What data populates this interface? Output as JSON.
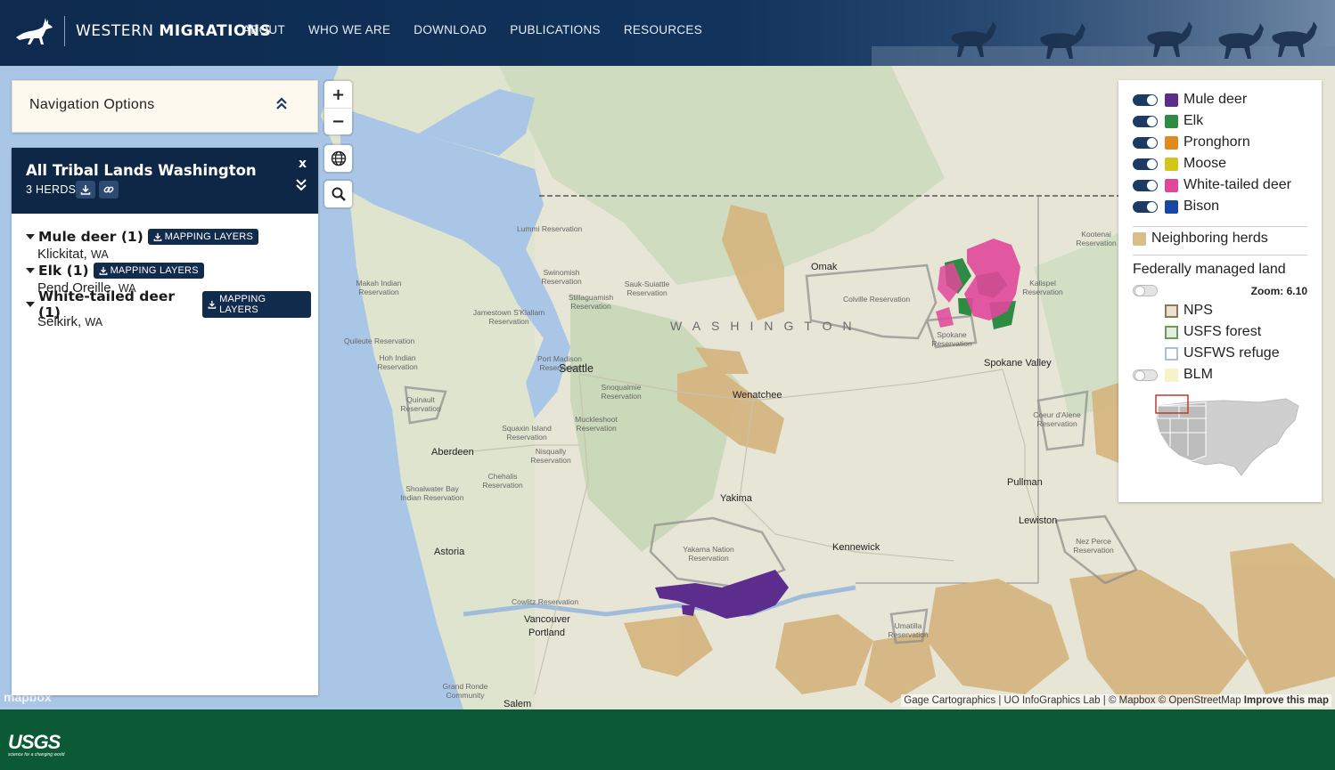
{
  "header": {
    "brand_light": "WESTERN ",
    "brand_bold": "MIGRATIONS",
    "nav": [
      "ABOUT",
      "WHO WE ARE",
      "DOWNLOAD",
      "PUBLICATIONS",
      "RESOURCES"
    ]
  },
  "nav_options": {
    "title": "Navigation Options"
  },
  "herd_panel": {
    "title": "All Tribal Lands Washington",
    "count": "3 HERDS",
    "close": "x",
    "herds": [
      {
        "name": "Mule deer (1)",
        "button": "MAPPING LAYERS",
        "location": "Klickitat,",
        "state": "WA"
      },
      {
        "name": "Elk (1)",
        "button": "MAPPING LAYERS",
        "location": "Pend Oreille,",
        "state": "WA"
      },
      {
        "name": "White-tailed deer (1)",
        "button": "MAPPING LAYERS",
        "location": "Selkirk,",
        "state": "WA"
      }
    ]
  },
  "controls": {
    "zoom_in": "+",
    "zoom_out": "−"
  },
  "legend": {
    "species": [
      {
        "label": "Mule deer",
        "color": "#5c2d8c",
        "on": true
      },
      {
        "label": "Elk",
        "color": "#2e8b43",
        "on": true
      },
      {
        "label": "Pronghorn",
        "color": "#e08a1e",
        "on": true
      },
      {
        "label": "Moose",
        "color": "#d4c51a",
        "on": true
      },
      {
        "label": "White-tailed deer",
        "color": "#e0479a",
        "on": true
      },
      {
        "label": "Bison",
        "color": "#1747a6",
        "on": true
      }
    ],
    "neighboring": {
      "label": "Neighboring herds",
      "color": "#d9be88"
    },
    "federal_title": "Federally managed land",
    "zoom": "Zoom: 6.10",
    "federal": [
      {
        "label": "NPS",
        "fill": "#e9e2d0",
        "border": "#8a7a5a"
      },
      {
        "label": "USFS forest",
        "fill": "#e2eedd",
        "border": "#6f9a5a"
      },
      {
        "label": "USFWS refuge",
        "fill": "#ffffff",
        "border": "#a8c0dd"
      },
      {
        "label": "BLM",
        "fill": "#f7f3c8",
        "border": "#f7f3c8"
      }
    ]
  },
  "map": {
    "state_label": "WASHINGTON",
    "cities": [
      {
        "name": "Seattle"
      },
      {
        "name": "Omak"
      },
      {
        "name": "Spokane Valley"
      },
      {
        "name": "Wenatchee"
      },
      {
        "name": "Aberdeen"
      },
      {
        "name": "Yakima"
      },
      {
        "name": "Pullman"
      },
      {
        "name": "Lewiston"
      },
      {
        "name": "Kennewick"
      },
      {
        "name": "Astoria"
      },
      {
        "name": "Vancouver"
      },
      {
        "name": "Portland"
      },
      {
        "name": "Salem"
      }
    ],
    "reservations": [
      "Lummi Reservation",
      "Swinomish Reservation",
      "Sauk-Suiattle Reservation",
      "Stillaguamish Reservation",
      "Makah Indian Reservation",
      "Jamestown S'Klallam Reservation",
      "Quileute Reservation",
      "Hoh Indian Reservation",
      "Port Madison Reservation",
      "Snoqualmie Reservation",
      "Muckleshoot Reservation",
      "Quinault Reservation",
      "Squaxin Island Reservation",
      "Nisqually Reservation",
      "Chehalis Reservation",
      "Shoalwater Bay Indian Reservation",
      "Colville Reservation",
      "Spokane Reservation",
      "Kalispel Reservation",
      "Kootenai Reservation",
      "Coeur d'Alene Reservation",
      "Yakama Nation Reservation",
      "Nez Perce Reservation",
      "Umatilla Reservation",
      "Cowlitz Reservation",
      "Grand Ronde Community"
    ],
    "mapbox": "mapbox",
    "attribution": "Gage Cartographics | UO InfoGraphics Lab | © Mapbox © OpenStreetMap",
    "improve": "Improve this map"
  },
  "footer": {
    "logo": "USGS",
    "tagline": "science for a changing world"
  }
}
